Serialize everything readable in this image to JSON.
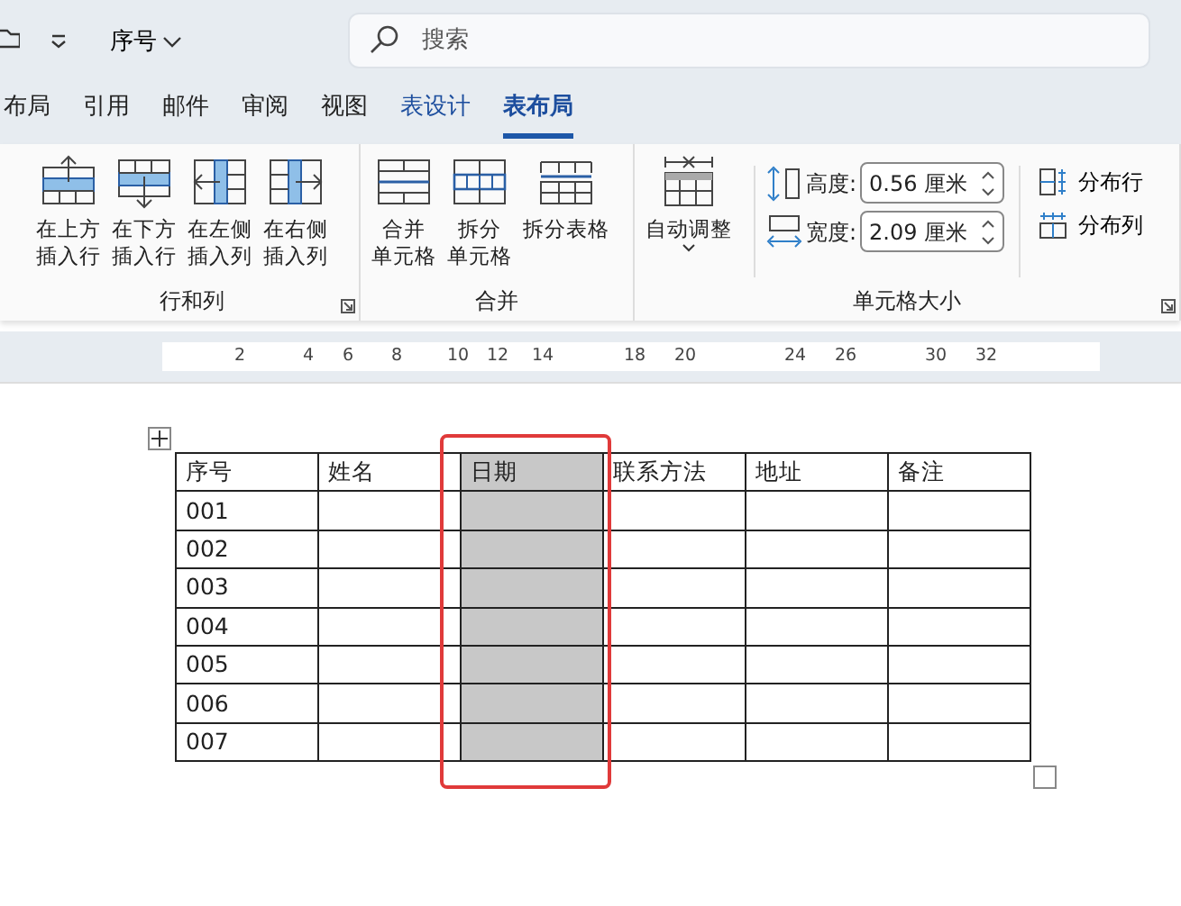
{
  "title_bar": {
    "document_title": "序号",
    "search": {
      "placeholder": "搜索"
    }
  },
  "tabs": [
    {
      "label": "布局",
      "selected": false,
      "kind": "plain"
    },
    {
      "label": "引用",
      "selected": false,
      "kind": "plain"
    },
    {
      "label": "邮件",
      "selected": false,
      "kind": "plain"
    },
    {
      "label": "审阅",
      "selected": false,
      "kind": "plain"
    },
    {
      "label": "视图",
      "selected": false,
      "kind": "plain"
    },
    {
      "label": "表设计",
      "selected": false,
      "kind": "contextual"
    },
    {
      "label": "表布局",
      "selected": true,
      "kind": "contextual"
    }
  ],
  "ribbon": {
    "groups": [
      {
        "label": "行和列",
        "launcher": true,
        "buttons": [
          {
            "kind": "insert-above",
            "lines": [
              "在上方",
              "插入行"
            ]
          },
          {
            "kind": "insert-below",
            "lines": [
              "在下方",
              "插入行"
            ]
          },
          {
            "kind": "insert-left",
            "lines": [
              "在左侧",
              "插入列"
            ]
          },
          {
            "kind": "insert-right",
            "lines": [
              "在右侧",
              "插入列"
            ]
          }
        ]
      },
      {
        "label": "合并",
        "launcher": false,
        "buttons": [
          {
            "kind": "merge",
            "lines": [
              "合并",
              "单元格"
            ]
          },
          {
            "kind": "split",
            "lines": [
              "拆分",
              "单元格"
            ]
          },
          {
            "kind": "split-table",
            "lines": [
              "拆分表格"
            ]
          }
        ]
      },
      {
        "label": "单元格大小",
        "launcher": true,
        "autofit": {
          "label": "自动调整"
        },
        "sizes": [
          {
            "kind": "height",
            "label": "高度:",
            "value": "0.56 厘米"
          },
          {
            "kind": "width",
            "label": "宽度:",
            "value": "2.09 厘米"
          }
        ],
        "distribute": [
          {
            "kind": "rows",
            "label": "分布行"
          },
          {
            "kind": "columns",
            "label": "分布列"
          }
        ]
      }
    ]
  },
  "ruler": {
    "numbers": [
      "2",
      "4",
      "6",
      "8",
      "10",
      "12",
      "14",
      "18",
      "20",
      "24",
      "26",
      "30",
      "32"
    ]
  },
  "table": {
    "columns": [
      {
        "header": "序号",
        "selected": false
      },
      {
        "header": "姓名",
        "selected": false
      },
      {
        "header": "日期",
        "selected": true
      },
      {
        "header": "联系方法",
        "selected": false
      },
      {
        "header": "地址",
        "selected": false
      },
      {
        "header": "备注",
        "selected": false
      }
    ],
    "rows": [
      [
        "001",
        "",
        "",
        "",
        "",
        ""
      ],
      [
        "002",
        "",
        "",
        "",
        "",
        ""
      ],
      [
        "003",
        "",
        "",
        "",
        "",
        ""
      ],
      [
        "004",
        "",
        "",
        "",
        "",
        ""
      ],
      [
        "005",
        "",
        "",
        "",
        "",
        ""
      ],
      [
        "006",
        "",
        "",
        "",
        "",
        ""
      ],
      [
        "007",
        "",
        "",
        "",
        "",
        ""
      ]
    ]
  }
}
